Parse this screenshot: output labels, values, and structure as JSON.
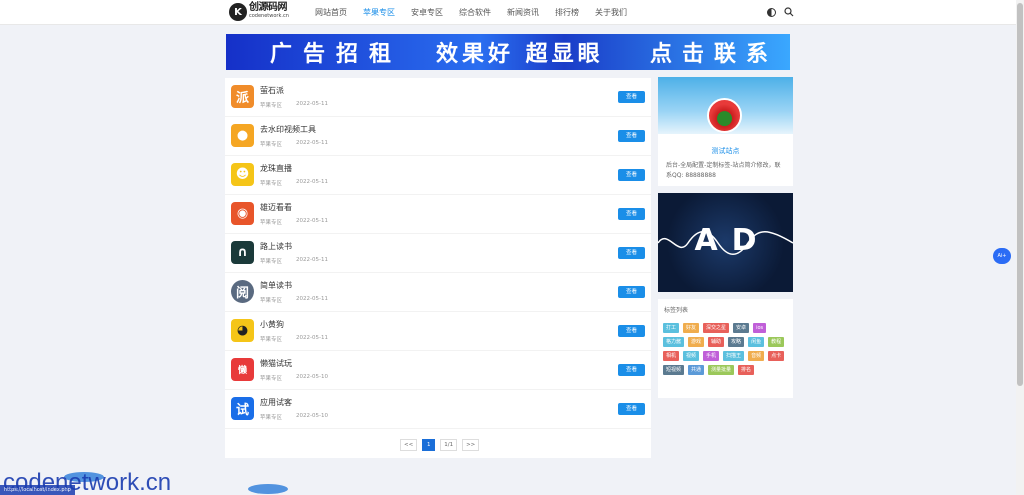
{
  "logo": {
    "mark": "K",
    "name": "创源码网",
    "domain": "codenetwork.cn"
  },
  "nav": [
    {
      "label": "网站首页",
      "active": false
    },
    {
      "label": "苹果专区",
      "active": true
    },
    {
      "label": "安卓专区",
      "active": false
    },
    {
      "label": "综合软件",
      "active": false
    },
    {
      "label": "新闻资讯",
      "active": false
    },
    {
      "label": "排行榜",
      "active": false
    },
    {
      "label": "关于我们",
      "active": false
    }
  ],
  "banner": {
    "left": "广告招租",
    "middle": "效果好 超显眼",
    "right": "点击联系"
  },
  "apps": [
    {
      "title": "萤石派",
      "category": "苹果专区",
      "date": "2022-05-11",
      "button": "查看",
      "icon_char": "派",
      "icon_color": "#f08c2a"
    },
    {
      "title": "去水印视频工具",
      "category": "苹果专区",
      "date": "2022-05-11",
      "button": "查看",
      "icon_char": "●",
      "icon_color": "#f5a623"
    },
    {
      "title": "龙珠直播",
      "category": "苹果专区",
      "date": "2022-05-11",
      "button": "查看",
      "icon_char": "☻",
      "icon_color": "#f5c518"
    },
    {
      "title": "雄迈看看",
      "category": "苹果专区",
      "date": "2022-05-11",
      "button": "查看",
      "icon_char": "◉",
      "icon_color": "#e8552a"
    },
    {
      "title": "路上读书",
      "category": "苹果专区",
      "date": "2022-05-11",
      "button": "查看",
      "icon_char": "∩",
      "icon_color": "#1b3a3a"
    },
    {
      "title": "简单读书",
      "category": "苹果专区",
      "date": "2022-05-11",
      "button": "查看",
      "icon_char": "阅",
      "icon_color": "#5a6a80"
    },
    {
      "title": "小黄狗",
      "category": "苹果专区",
      "date": "2022-05-11",
      "button": "查看",
      "icon_char": "◕",
      "icon_color": "#f5c518"
    },
    {
      "title": "懒猫试玩",
      "category": "苹果专区",
      "date": "2022-05-10",
      "button": "查看",
      "icon_char": "懒",
      "icon_color": "#e83a3a"
    },
    {
      "title": "应用试客",
      "category": "苹果专区",
      "date": "2022-05-10",
      "button": "查看",
      "icon_char": "试",
      "icon_color": "#1a6ee8"
    }
  ],
  "pager": {
    "prev": "<<",
    "current": "1",
    "total": "1/1",
    "next": ">>"
  },
  "profile": {
    "name": "测试站点",
    "desc": "后台-全局配置-定制标签-站点简介修改，联系QQ: 88888888"
  },
  "ad": {
    "text": "AD"
  },
  "tags": {
    "title": "标签列表",
    "items": [
      {
        "label": "打工",
        "color": "#5bc0de"
      },
      {
        "label": "好友",
        "color": "#f0ad4e"
      },
      {
        "label": "深交之星",
        "color": "#e8605a"
      },
      {
        "label": "安卓",
        "color": "#5b7a90"
      },
      {
        "label": "ios",
        "color": "#c05fd8"
      },
      {
        "label": "格力酱",
        "color": "#5bc0de"
      },
      {
        "label": "游戏",
        "color": "#f0ad4e"
      },
      {
        "label": "辅助",
        "color": "#e8605a"
      },
      {
        "label": "攻略",
        "color": "#5b7a90"
      },
      {
        "label": "闲鱼",
        "color": "#5bc0de"
      },
      {
        "label": "教程",
        "color": "#9bc85a"
      },
      {
        "label": "相机",
        "color": "#e8605a"
      },
      {
        "label": "视频",
        "color": "#5bc0de"
      },
      {
        "label": "手机",
        "color": "#c05fd8"
      },
      {
        "label": "扫描王",
        "color": "#5bc0de"
      },
      {
        "label": "音频",
        "color": "#f0ad4e"
      },
      {
        "label": "点卡",
        "color": "#e8605a"
      },
      {
        "label": "短视频",
        "color": "#5b7a90"
      },
      {
        "label": "共通",
        "color": "#5b9ad8"
      },
      {
        "label": "测量批量",
        "color": "#9bc85a"
      },
      {
        "label": "排名",
        "color": "#e8605a"
      }
    ]
  },
  "fab": {
    "label": "Ai+"
  },
  "watermark": {
    "text": "codenetwork.cn"
  },
  "status": {
    "text": "https://localhost/index.php"
  }
}
